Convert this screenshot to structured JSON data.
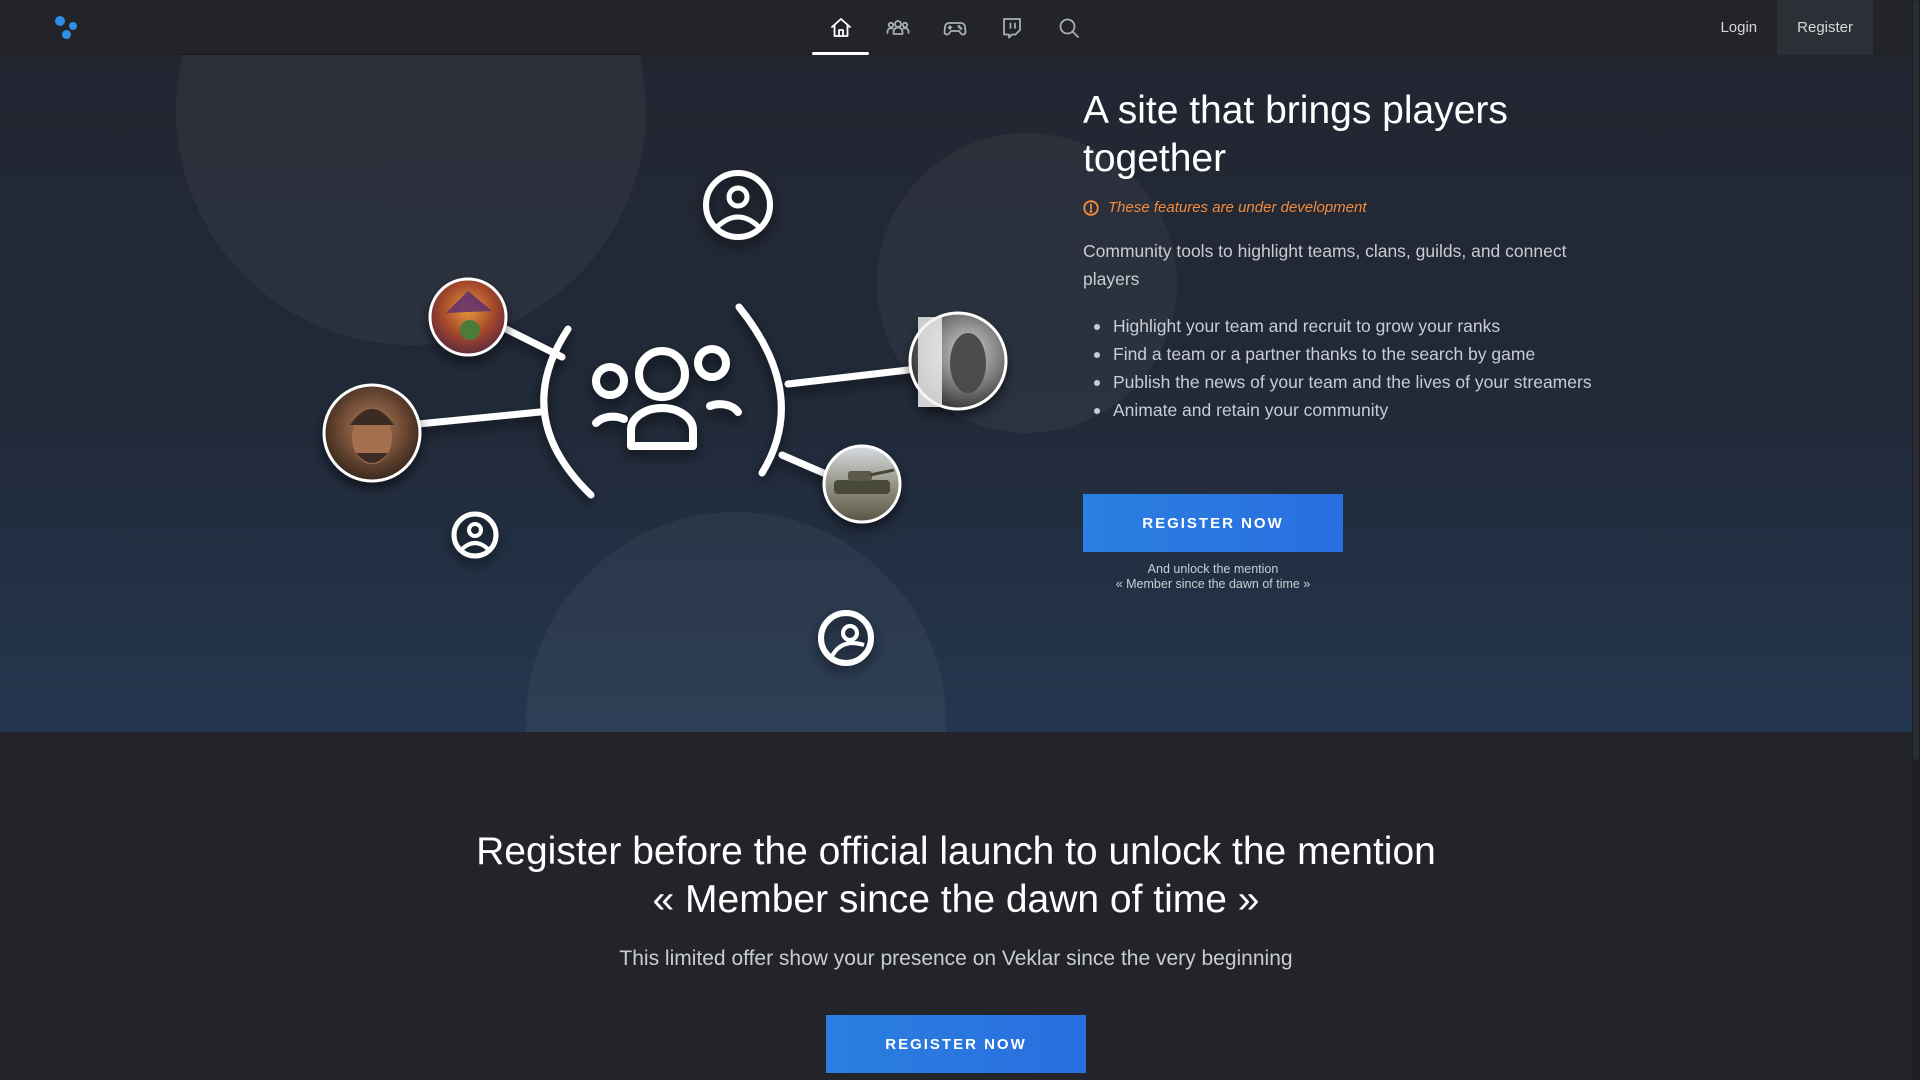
{
  "nav": {
    "items": [
      {
        "icon": "home-icon",
        "active": true
      },
      {
        "icon": "users-icon",
        "active": false
      },
      {
        "icon": "gamepad-icon",
        "active": false
      },
      {
        "icon": "twitch-icon",
        "active": false
      },
      {
        "icon": "search-icon",
        "active": false
      }
    ],
    "login": "Login",
    "register": "Register"
  },
  "hero": {
    "title": "A site that brings players together",
    "dev_note": "These features are under development",
    "description": "Community tools to highlight teams, clans, guilds, and connect players",
    "features": [
      "Highlight your team and recruit to grow your ranks",
      "Find a team or a partner thanks to the search by game",
      "Publish the news of your team and the lives of your streamers",
      "Animate and retain your community"
    ],
    "cta": "REGISTER NOW",
    "cta_caption_line1": "And unlock the mention",
    "cta_caption_line2": "« Member since the dawn of time »"
  },
  "promo": {
    "title_line1": "Register before the official launch to unlock the mention",
    "title_line2": "« Member since the dawn of time »",
    "subtitle": "This limited offer show your presence on Veklar since the very beginning",
    "cta": "REGISTER NOW"
  },
  "colors": {
    "accent": "#2a7fe0",
    "warning": "#f28c3f",
    "background": "#222429"
  }
}
